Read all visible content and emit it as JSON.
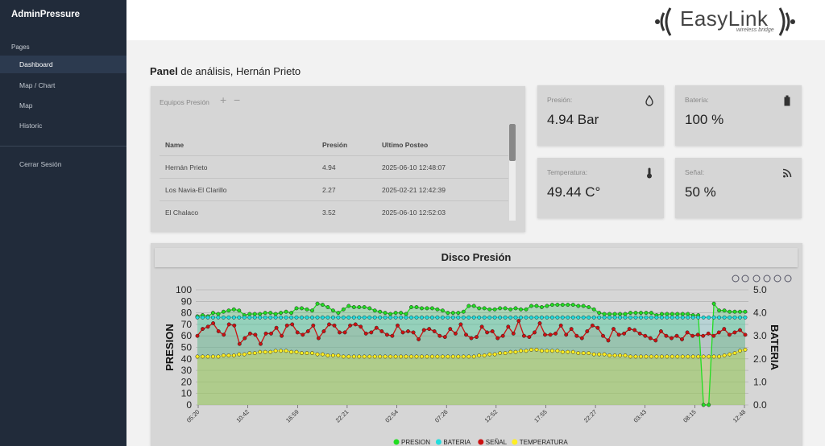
{
  "sidebar": {
    "brand": "AdminPressure",
    "section": "Pages",
    "items": [
      {
        "label": "Dashboard"
      },
      {
        "label": "Map / Chart"
      },
      {
        "label": "Map"
      },
      {
        "label": "Historic"
      }
    ],
    "logout": "Cerrar Sesión"
  },
  "header": {
    "logo_text": "EasyLink",
    "logo_sub": "wireless bridge"
  },
  "page": {
    "title_bold": "Panel",
    "title_rest": " de análisis, Hernán Prieto"
  },
  "equipos": {
    "title": "Equipos Presión",
    "add": "+",
    "remove": "−",
    "columns": [
      "Name",
      "Presión",
      "Ultimo Posteo"
    ],
    "rows": [
      [
        "Hernán Prieto",
        "4.94",
        "2025-06-10 12:48:07"
      ],
      [
        "Los Navia-El Clarillo",
        "2.27",
        "2025-02-21 12:42:39"
      ],
      [
        "El Chalaco",
        "3.52",
        "2025-06-10 12:52:03"
      ]
    ]
  },
  "stats": {
    "presion": {
      "label": "Presión:",
      "value": "4.94 Bar",
      "icon": "water-drop-icon"
    },
    "bateria": {
      "label": "Batería:",
      "value": "100 %",
      "icon": "battery-icon"
    },
    "temperatura": {
      "label": "Temperatura:",
      "value": "49.44 C°",
      "icon": "thermometer-icon"
    },
    "senal": {
      "label": "Señal:",
      "value": "50 %",
      "icon": "signal-icon"
    }
  },
  "chart_data": {
    "type": "line",
    "title": "Disco Presión",
    "ylabel": "PRESION",
    "y2label": "BATERIA",
    "ylim": [
      0,
      100
    ],
    "y2lim": [
      0,
      5
    ],
    "yticks": [
      "100",
      "90",
      "80",
      "70",
      "60",
      "50",
      "40",
      "30",
      "20",
      "10",
      "0"
    ],
    "y2ticks": [
      "5.0",
      "4.0",
      "3.0",
      "2.0",
      "1.0",
      "0.0"
    ],
    "xticks": [
      "05:20",
      "10:42",
      "16:59",
      "22:21",
      "02:54",
      "07:26",
      "12:52",
      "17:55",
      "22:27",
      "03:43",
      "08:15",
      "12:48"
    ],
    "legend_position": "bottom",
    "series": [
      {
        "name": "PRESION",
        "color": "#22dd22",
        "values": [
          77,
          78,
          77,
          80,
          79,
          81,
          82,
          83,
          82,
          78,
          79,
          79,
          79,
          80,
          80,
          79,
          80,
          81,
          80,
          84,
          84,
          83,
          82,
          88,
          87,
          85,
          82,
          80,
          83,
          86,
          85,
          85,
          85,
          84,
          82,
          81,
          80,
          79,
          80,
          80,
          79,
          85,
          85,
          84,
          84,
          84,
          83,
          82,
          80,
          80,
          80,
          81,
          86,
          86,
          84,
          84,
          83,
          83,
          84,
          84,
          83,
          84,
          83,
          83,
          86,
          86,
          85,
          86,
          87,
          87,
          87,
          87,
          87,
          86,
          86,
          85,
          83,
          80,
          79,
          79,
          79,
          79,
          79,
          80,
          80,
          80,
          80,
          80,
          78,
          79,
          79,
          79,
          79,
          79,
          79,
          78,
          78,
          0,
          0,
          88,
          82,
          82,
          81,
          81,
          81,
          81
        ]
      },
      {
        "name": "BATERIA",
        "color": "#22dddd",
        "values": [
          76,
          76,
          76,
          76,
          76,
          76,
          76,
          76,
          76,
          76,
          76,
          76,
          76,
          76,
          76,
          76,
          76,
          76,
          76,
          76,
          76,
          76,
          76,
          76,
          76,
          76,
          76,
          76,
          76,
          76,
          76,
          76,
          76,
          76,
          76,
          76,
          76,
          76,
          76,
          76,
          76,
          76,
          76,
          76,
          76,
          76,
          76,
          76,
          76,
          76,
          76,
          76,
          76,
          76,
          76,
          76,
          76,
          76,
          76,
          76,
          76,
          76,
          76,
          76,
          76,
          76,
          76,
          76,
          76,
          76,
          76,
          76,
          76,
          76,
          76,
          76,
          76,
          76,
          76,
          76,
          76,
          76,
          76,
          76,
          76,
          76,
          76,
          76,
          76,
          76,
          76,
          76,
          76,
          76,
          76,
          76,
          76,
          76,
          76,
          76,
          76,
          76,
          76,
          76,
          76,
          76
        ]
      },
      {
        "name": "SEÑAL",
        "color": "#cc1111",
        "values": [
          60,
          66,
          68,
          71,
          64,
          61,
          70,
          69,
          53,
          58,
          62,
          61,
          53,
          62,
          62,
          67,
          60,
          69,
          70,
          63,
          61,
          64,
          69,
          58,
          64,
          70,
          69,
          63,
          63,
          69,
          70,
          68,
          62,
          63,
          67,
          64,
          61,
          60,
          69,
          63,
          64,
          63,
          57,
          65,
          66,
          64,
          60,
          59,
          66,
          62,
          70,
          61,
          58,
          59,
          68,
          63,
          64,
          58,
          60,
          68,
          62,
          73,
          60,
          59,
          63,
          71,
          61,
          61,
          62,
          69,
          61,
          66,
          60,
          58,
          64,
          69,
          67,
          60,
          56,
          66,
          61,
          62,
          66,
          65,
          62,
          60,
          58,
          56,
          64,
          60,
          58,
          60,
          57,
          63,
          60,
          61,
          60,
          62,
          60,
          63,
          66,
          61,
          63,
          65,
          61
        ]
      },
      {
        "name": "TEMPERATURA",
        "color": "#ffee22",
        "values": [
          42,
          42,
          42,
          42,
          42,
          43,
          43,
          43,
          44,
          44,
          45,
          45,
          46,
          46,
          46,
          47,
          47,
          47,
          46,
          46,
          45,
          45,
          45,
          44,
          44,
          43,
          43,
          43,
          42,
          42,
          42,
          42,
          42,
          42,
          42,
          42,
          42,
          42,
          42,
          42,
          42,
          42,
          42,
          42,
          42,
          42,
          42,
          42,
          42,
          42,
          42,
          42,
          42,
          42,
          43,
          43,
          44,
          44,
          45,
          45,
          46,
          46,
          47,
          47,
          48,
          48,
          47,
          47,
          47,
          47,
          46,
          46,
          46,
          45,
          45,
          45,
          44,
          44,
          44,
          43,
          43,
          43,
          43,
          42,
          42,
          42,
          42,
          42,
          42,
          42,
          42,
          42,
          42,
          42,
          42,
          42,
          42,
          42,
          42,
          42,
          42,
          43,
          44,
          45,
          47,
          48
        ]
      }
    ]
  }
}
